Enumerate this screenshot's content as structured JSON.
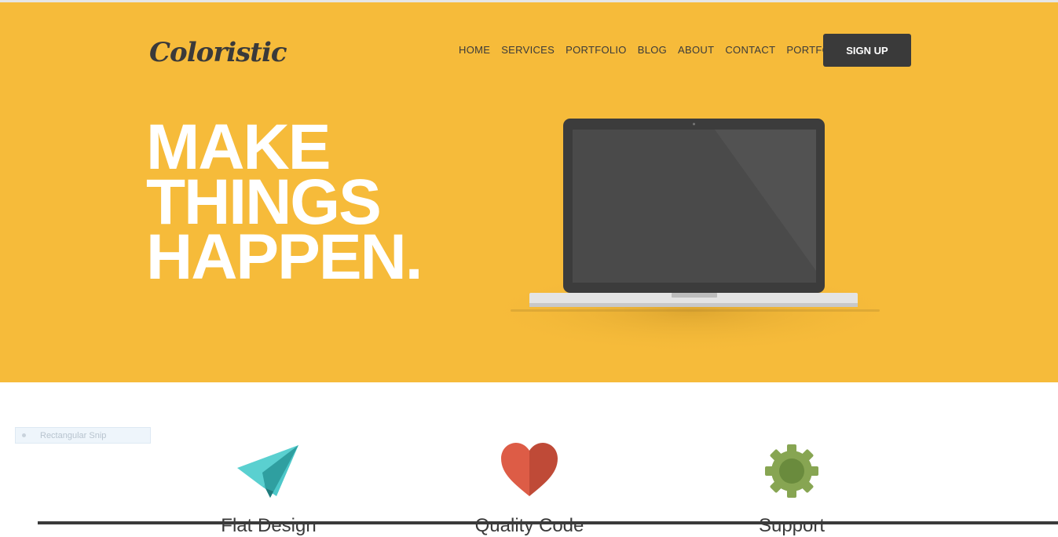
{
  "header": {
    "logo_text": "Coloristic",
    "nav": [
      "HOME",
      "SERVICES",
      "PORTFOLIO",
      "BLOG",
      "ABOUT",
      "CONTACT",
      "PORTFOLIO"
    ],
    "signup_label": "SIGN UP"
  },
  "hero": {
    "headline": [
      "MAKE",
      "THINGS",
      "HAPPEN."
    ],
    "background_color": "#f6bb3a"
  },
  "snip_tooltip": "Rectangular Snip",
  "features": [
    {
      "icon": "paper-plane-icon",
      "title": "Flat Design"
    },
    {
      "icon": "heart-icon",
      "title": "Quality Code"
    },
    {
      "icon": "gear-icon",
      "title": "Support"
    }
  ],
  "colors": {
    "accent_dark": "#3a3a3a",
    "plane": "#4dc8c9",
    "heart": "#d65a44",
    "gear": "#87a552"
  }
}
